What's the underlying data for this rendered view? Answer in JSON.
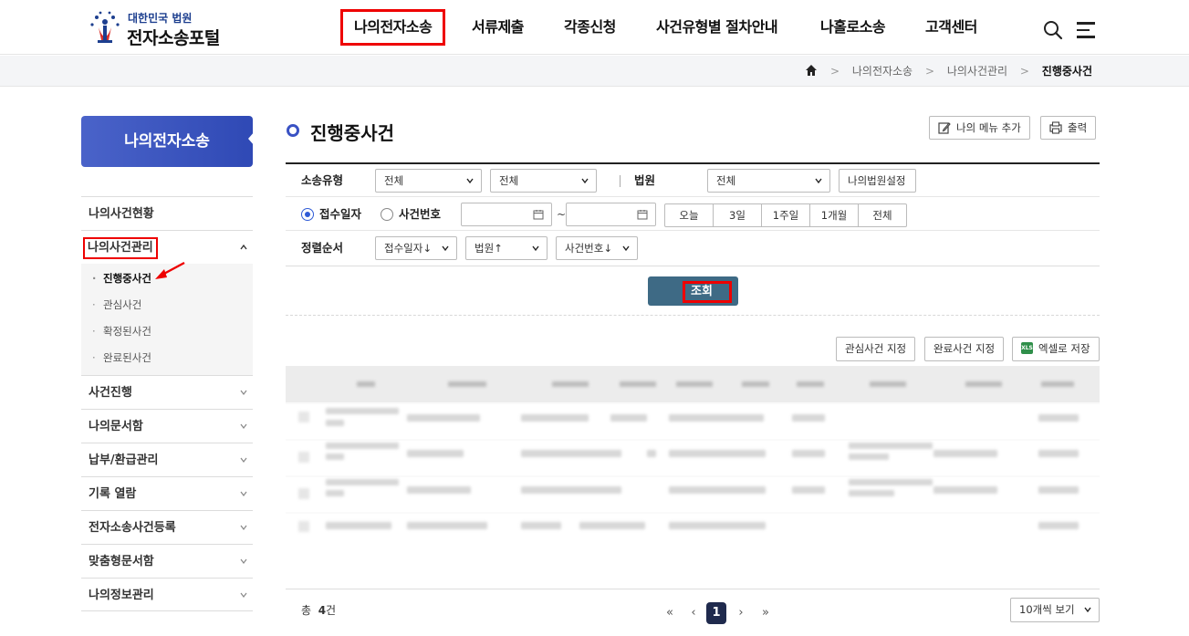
{
  "header": {
    "logo_top": "대한민국 법원",
    "logo_main": "전자소송포털",
    "nav": [
      "나의전자소송",
      "서류제출",
      "각종신청",
      "사건유형별 절차안내",
      "나홀로소송",
      "고객센터"
    ],
    "nav_highlighted": "나의전자소송"
  },
  "breadcrumb": [
    "나의전자소송",
    "나의사건관리",
    "진행중사건"
  ],
  "sidebar": {
    "title": "나의전자소송",
    "items": [
      {
        "label": "나의사건현황"
      },
      {
        "label": "나의사건관리",
        "open": true,
        "sub": [
          "진행중사건",
          "관심사건",
          "확정된사건",
          "완료된사건"
        ]
      },
      {
        "label": "사건진행"
      },
      {
        "label": "나의문서함"
      },
      {
        "label": "납부/환급관리"
      },
      {
        "label": "기록 열람"
      },
      {
        "label": "전자소송사건등록"
      },
      {
        "label": "맞춤형문서함"
      },
      {
        "label": "나의정보관리"
      }
    ],
    "active_sub": "진행중사건"
  },
  "main": {
    "title": "진행중사건",
    "add_menu_label": "나의 메뉴 추가",
    "print_label": "출력",
    "filter": {
      "case_type_label": "소송유형",
      "case_type_1": "전체",
      "case_type_2": "전체",
      "court_label": "법원",
      "court_value": "전체",
      "court_setting_label": "나의법원설정",
      "radio_receipt": "접수일자",
      "radio_case_no": "사건번호",
      "tilde": "~",
      "periods": [
        "오늘",
        "3일",
        "1주일",
        "1개월",
        "전체"
      ],
      "sort_label": "정렬순서",
      "sort_1": "접수일자↓",
      "sort_2": "법원↑",
      "sort_3": "사건번호↓"
    },
    "search_label": "조회",
    "actions": {
      "interest": "관심사건 지정",
      "complete": "완료사건 지정",
      "excel": "엑셀로 저장",
      "excel_icon_text": "XLS"
    },
    "total_prefix": "총",
    "total_count": "4",
    "total_suffix": "건",
    "pager": {
      "first": "«",
      "prev": "‹",
      "current": "1",
      "next": "›",
      "last": "»"
    },
    "rows_per_page": "10개씩 보기"
  }
}
